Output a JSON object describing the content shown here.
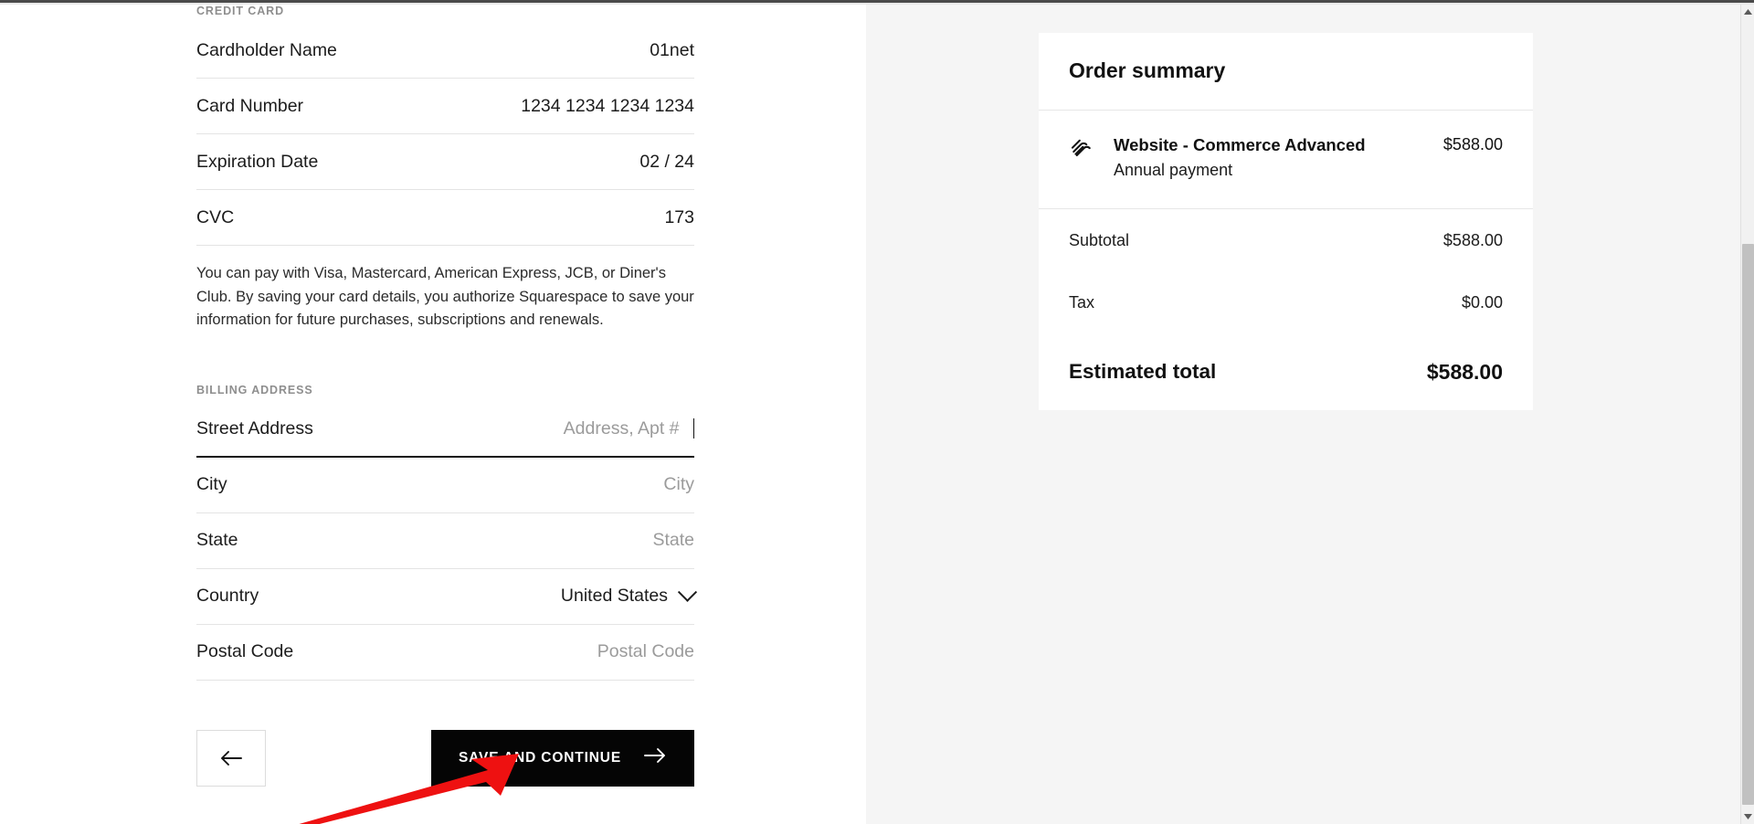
{
  "credit_card": {
    "section_label": "CREDIT CARD",
    "fields": [
      {
        "label": "Cardholder Name",
        "value": "01net",
        "is_placeholder": false
      },
      {
        "label": "Card Number",
        "value": "1234 1234 1234 1234",
        "is_placeholder": false
      },
      {
        "label": "Expiration Date",
        "value": "02 / 24",
        "is_placeholder": false
      },
      {
        "label": "CVC",
        "value": "173",
        "is_placeholder": false
      }
    ],
    "disclaimer": "You can pay with Visa, Mastercard, American Express, JCB, or Diner's Club. By saving your card details, you authorize Squarespace to save your information for future purchases, subscriptions and renewals."
  },
  "billing_address": {
    "section_label": "BILLING ADDRESS",
    "street": {
      "label": "Street Address",
      "placeholder": "Address, Apt #",
      "value": "",
      "focused": true
    },
    "city": {
      "label": "City",
      "placeholder": "City",
      "value": ""
    },
    "state": {
      "label": "State",
      "placeholder": "State",
      "value": ""
    },
    "country": {
      "label": "Country",
      "value": "United States",
      "icon": "chevron-down-icon"
    },
    "postal": {
      "label": "Postal Code",
      "placeholder": "Postal Code",
      "value": ""
    }
  },
  "actions": {
    "back_icon": "arrow-left-icon",
    "save_label": "Save and Continue",
    "save_icon": "arrow-right-icon",
    "annotation_icon": "red-arrow-annotation",
    "annotation_color": "#ee1111"
  },
  "order_summary": {
    "title": "Order summary",
    "line_item": {
      "icon": "squarespace-logo-icon",
      "name": "Website - Commerce Advanced",
      "subtitle": "Annual payment",
      "price": "$588.00"
    },
    "rows": [
      {
        "label": "Subtotal",
        "value": "$588.00"
      },
      {
        "label": "Tax",
        "value": "$0.00"
      }
    ],
    "grand_total": {
      "label": "Estimated total",
      "value": "$588.00"
    }
  },
  "scrollbar": {
    "up_icon": "scroll-up-arrow-icon",
    "down_icon": "scroll-down-arrow-icon"
  }
}
